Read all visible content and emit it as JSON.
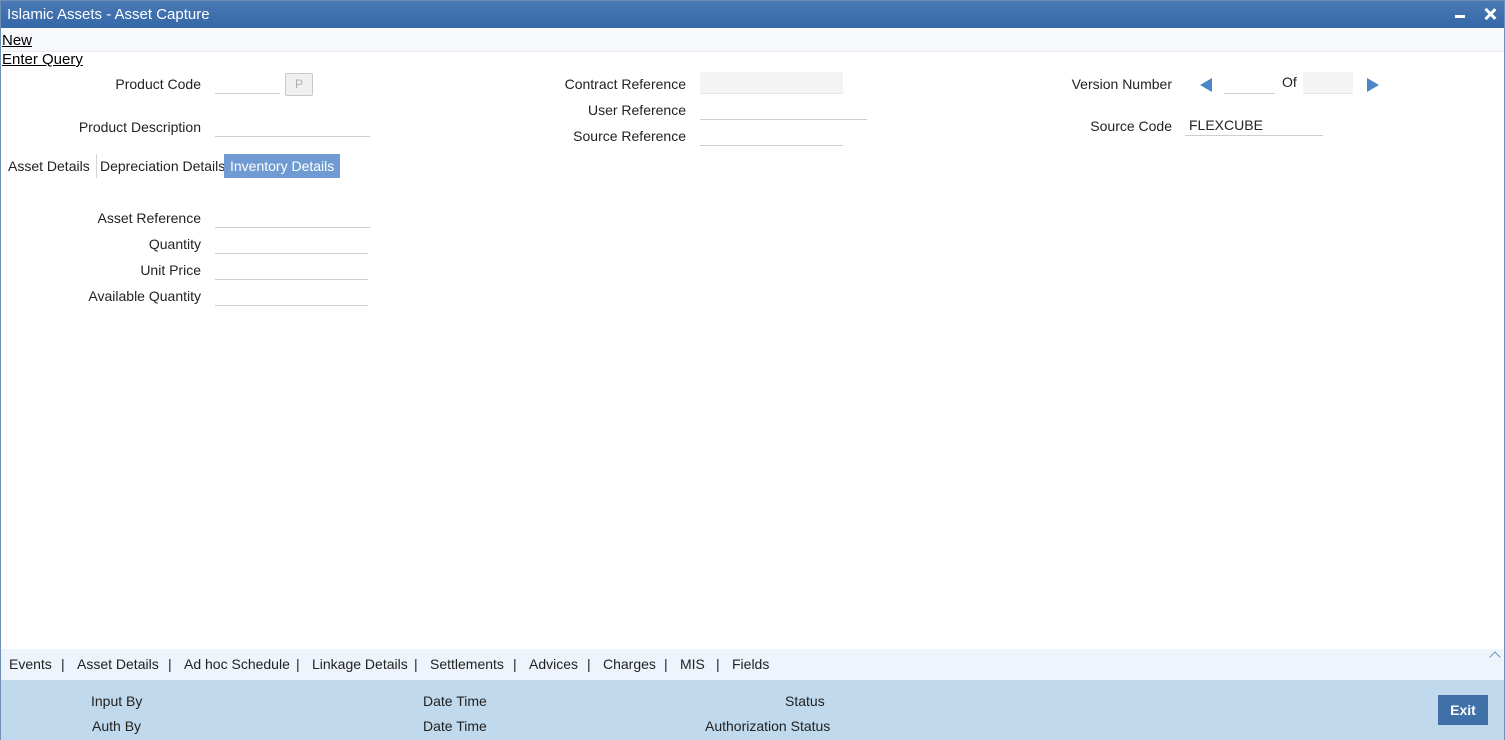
{
  "window": {
    "title": "Islamic Assets - Asset Capture"
  },
  "toolbar": {
    "new": "New",
    "enter_query": "Enter Query"
  },
  "header": {
    "product_code_label": "Product Code",
    "product_code_value": "",
    "lov_button": "P",
    "product_description_label": "Product Description",
    "product_description_value": "",
    "contract_reference_label": "Contract Reference",
    "contract_reference_value": "",
    "user_reference_label": "User Reference",
    "user_reference_value": "",
    "source_reference_label": "Source Reference",
    "source_reference_value": "",
    "version_number_label": "Version Number",
    "version_current": "",
    "version_of_label": "Of",
    "version_total": "",
    "source_code_label": "Source Code",
    "source_code_value": "FLEXCUBE"
  },
  "tabs": [
    {
      "label": "Asset Details",
      "active": false
    },
    {
      "label": "Depreciation Details",
      "active": false
    },
    {
      "label": "Inventory Details",
      "active": true
    }
  ],
  "inventory": {
    "asset_reference_label": "Asset Reference",
    "asset_reference_value": "",
    "quantity_label": "Quantity",
    "quantity_value": "",
    "unit_price_label": "Unit Price",
    "unit_price_value": "",
    "available_quantity_label": "Available Quantity",
    "available_quantity_value": ""
  },
  "subnav": {
    "items": [
      "Events",
      "Asset Details",
      "Ad hoc Schedule",
      "Linkage Details",
      "Settlements",
      "Advices",
      "Charges",
      "MIS",
      "Fields"
    ],
    "separator": "|"
  },
  "footer": {
    "input_by": "Input By",
    "auth_by": "Auth By",
    "date_time_1": "Date Time",
    "date_time_2": "Date Time",
    "status": "Status",
    "authorization_status": "Authorization Status",
    "exit": "Exit"
  },
  "colors": {
    "titlebar": "#3a6dab",
    "active_tab": "#6f9bd2",
    "footer": "#c0d9ec",
    "exit_button": "#3f70a8"
  }
}
